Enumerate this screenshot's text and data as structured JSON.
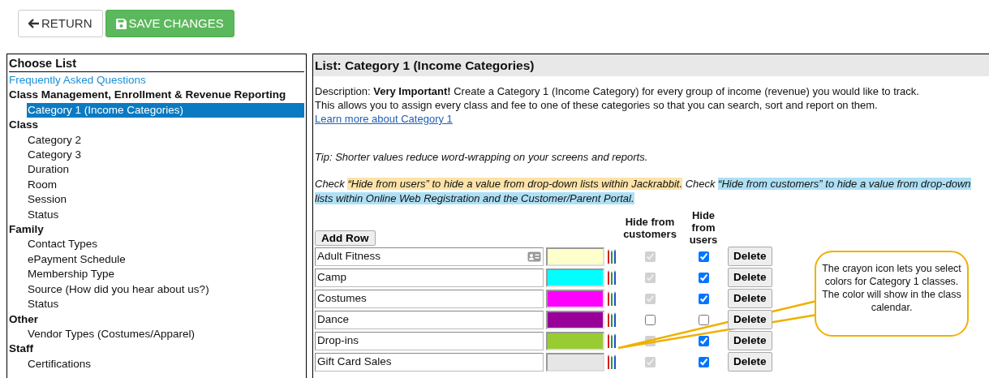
{
  "toolbar": {
    "buttons": [
      {
        "kind": "return",
        "label": "RETURN"
      },
      {
        "kind": "save",
        "label": "SAVE CHANGES"
      }
    ]
  },
  "sidebar": {
    "title": "Choose List",
    "link": "Frequently Asked Questions",
    "groups": [
      {
        "label": "Class Management, Enrollment & Revenue Reporting",
        "items": [
          {
            "label": "Category 1 (Income Categories)",
            "selected": true
          }
        ]
      },
      {
        "label": "Class",
        "items": [
          {
            "label": "Category 2",
            "selected": false
          },
          {
            "label": "Category 3",
            "selected": false
          },
          {
            "label": "Duration",
            "selected": false
          },
          {
            "label": "Room",
            "selected": false
          },
          {
            "label": "Session",
            "selected": false
          },
          {
            "label": "Status",
            "selected": false
          }
        ]
      },
      {
        "label": "Family",
        "items": [
          {
            "label": "Contact Types",
            "selected": false
          },
          {
            "label": "ePayment Schedule",
            "selected": false
          },
          {
            "label": "Membership Type",
            "selected": false
          },
          {
            "label": "Source (How did you hear about us?)",
            "selected": false
          },
          {
            "label": "Status",
            "selected": false
          }
        ]
      },
      {
        "label": "Other",
        "items": [
          {
            "label": "Vendor Types (Costumes/Apparel)",
            "selected": false
          }
        ]
      },
      {
        "label": "Staff",
        "items": [
          {
            "label": "Certifications",
            "selected": false
          }
        ]
      }
    ]
  },
  "panel": {
    "title": "List: Category 1 (Income Categories)",
    "description": {
      "lines": [
        "Description: **Very Important!** Create a Category 1 (Income Category) for every group of income (revenue) you would like to track.",
        "This allows you to assign every class and fee to one of these categories so that you can search, sort and report on them."
      ],
      "link": "Learn more about Category 1"
    },
    "tip": "Tip: Shorter values reduce word-wrapping on your screens and reports.",
    "check_note": [
      {
        "text": "Check "
      },
      {
        "text": "“Hide from users” to hide a value from drop-down lists within Jackrabbit.",
        "color": "#fde3a7"
      },
      {
        "text": " Check "
      },
      {
        "text": "“Hide from customers” to hide a value from drop-down lists within Online Web Registration and the Customer/Parent Portal. ",
        "color": "#aee0f5"
      }
    ],
    "add_button": "Add Row",
    "columns": [
      "Hide from customers",
      "Hide from users"
    ],
    "rows": [
      {
        "name": "Adult Fitness",
        "card_icon": true,
        "color": "#ffffcc",
        "hide_from_customers": {
          "checked": true,
          "disabled": true
        },
        "hide_from_users": {
          "checked": true
        },
        "delete": "Delete"
      },
      {
        "name": "Camp",
        "card_icon": false,
        "color": "#00ffff",
        "hide_from_customers": {
          "checked": true,
          "disabled": true
        },
        "hide_from_users": {
          "checked": true
        },
        "delete": "Delete"
      },
      {
        "name": "Costumes",
        "card_icon": false,
        "color": "#ff00ff",
        "hide_from_customers": {
          "checked": true,
          "disabled": true
        },
        "hide_from_users": {
          "checked": true
        },
        "delete": "Delete"
      },
      {
        "name": "Dance",
        "card_icon": false,
        "color": "#990099",
        "hide_from_customers": {
          "checked": false,
          "disabled": false
        },
        "hide_from_users": {
          "checked": false
        },
        "delete": "Delete"
      },
      {
        "name": "Drop-ins",
        "card_icon": false,
        "color": "#99cc33",
        "hide_from_customers": {
          "checked": true,
          "disabled": true
        },
        "hide_from_users": {
          "checked": true
        },
        "delete": "Delete"
      },
      {
        "name": "Gift Card Sales",
        "card_icon": false,
        "color": "#e6e6e6",
        "hide_from_customers": {
          "checked": true,
          "disabled": true
        },
        "hide_from_users": {
          "checked": true
        },
        "delete": "Delete"
      }
    ],
    "callout": {
      "lines": [
        "The crayon icon lets you select colors for Category 1 classes.",
        "The color will show in the class calendar."
      ]
    }
  }
}
